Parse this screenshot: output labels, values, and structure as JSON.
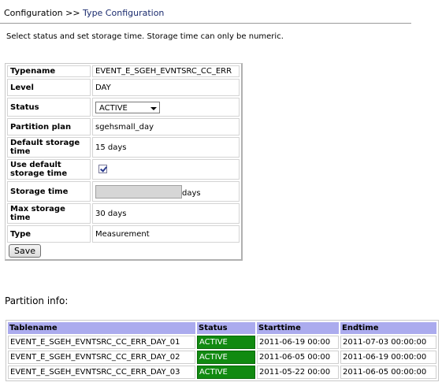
{
  "breadcrumb": {
    "root": "Configuration",
    "separator": ">>",
    "current": "Type Configuration"
  },
  "instructions": "Select status and set storage time. Storage time can only be numeric.",
  "form": {
    "typename_label": "Typename",
    "typename_value": "EVENT_E_SGEH_EVNTSRC_CC_ERR",
    "level_label": "Level",
    "level_value": "DAY",
    "status_label": "Status",
    "status_value": "ACTIVE",
    "partition_label": "Partition plan",
    "partition_value": "sgehsmall_day",
    "default_storage_label": "Default storage time",
    "default_storage_value": "15 days",
    "use_default_label": "Use default storage time",
    "use_default_checked": true,
    "storage_time_label": "Storage time",
    "storage_time_value": "",
    "storage_time_suffix": "days",
    "max_storage_label": "Max storage time",
    "max_storage_value": "30 days",
    "type_label": "Type",
    "type_value": "Measurement",
    "save_label": "Save"
  },
  "partition_info": {
    "title": "Partition info:",
    "headers": [
      "Tablename",
      "Status",
      "Starttime",
      "Endtime"
    ],
    "rows": [
      {
        "tablename": "EVENT_E_SGEH_EVNTSRC_CC_ERR_DAY_01",
        "status": "ACTIVE",
        "start": "2011-06-19 00:00",
        "end": "2011-07-03 00:00:00"
      },
      {
        "tablename": "EVENT_E_SGEH_EVNTSRC_CC_ERR_DAY_02",
        "status": "ACTIVE",
        "start": "2011-06-05 00:00",
        "end": "2011-06-19 00:00:00"
      },
      {
        "tablename": "EVENT_E_SGEH_EVNTSRC_CC_ERR_DAY_03",
        "status": "ACTIVE",
        "start": "2011-05-22 00:00",
        "end": "2011-06-05 00:00:00"
      }
    ]
  },
  "colors": {
    "header_bg": "#ababee",
    "status_active_bg": "#118a11",
    "breadcrumb_current": "#1a2b6e"
  }
}
